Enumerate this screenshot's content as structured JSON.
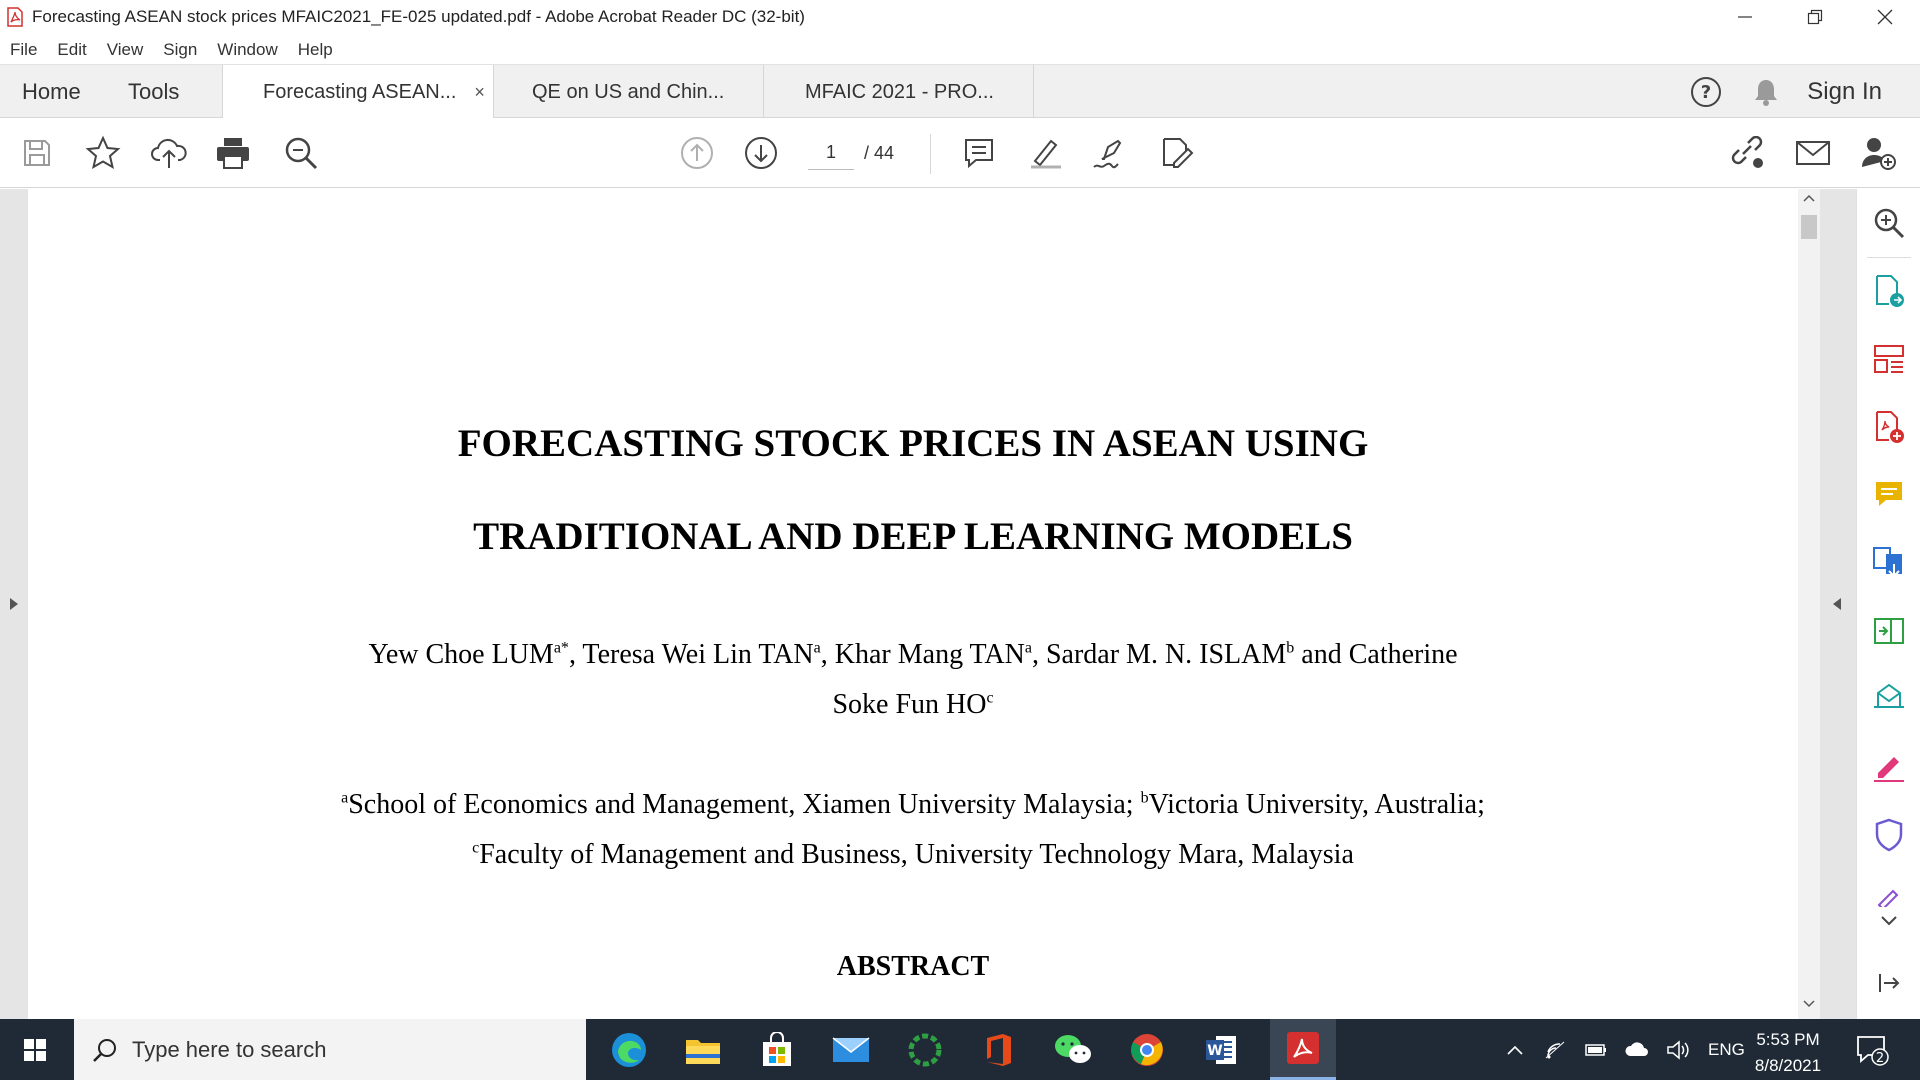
{
  "window": {
    "title": "Forecasting ASEAN stock prices MFAIC2021_FE-025 updated.pdf - Adobe Acrobat Reader DC (32-bit)",
    "app_icon": "acrobat-icon",
    "controls": [
      "minimize-icon",
      "restore-icon",
      "close-icon"
    ]
  },
  "menu": {
    "items": [
      "File",
      "Edit",
      "View",
      "Sign",
      "Window",
      "Help"
    ]
  },
  "tabs": {
    "home": "Home",
    "tools": "Tools",
    "documents": [
      {
        "label": "Forecasting ASEAN...",
        "active": true,
        "close": "×"
      },
      {
        "label": "QE on US and Chin...",
        "active": false
      },
      {
        "label": "MFAIC 2021 - PRO...",
        "active": false
      }
    ],
    "sign_in": "Sign In"
  },
  "toolbar": {
    "page_current": "1",
    "page_total": "/ 44"
  },
  "document": {
    "title_line1": "FORECASTING STOCK PRICES IN ASEAN USING",
    "title_line2": "TRADITIONAL AND DEEP LEARNING MODELS",
    "authors_line1": {
      "a1": "Yew Choe LUM",
      "a1_sup": "a*",
      "a2": ", Teresa Wei Lin TAN",
      "a2_sup": "a",
      "a3": ", Khar Mang TAN",
      "a3_sup": "a",
      "a4": ", Sardar M. N. ISLAM",
      "a4_sup": "b",
      "a5": " and Catherine"
    },
    "authors_line2": {
      "text": "Soke Fun HO",
      "sup": "c"
    },
    "affil_line1": {
      "sup1": "a",
      "t1": "School of Economics and Management, Xiamen University Malaysia; ",
      "sup2": "b",
      "t2": "Victoria University, Australia;"
    },
    "affil_line2": {
      "sup": "c",
      "text": "Faculty of Management and Business, University Technology Mara, Malaysia"
    },
    "abstract_heading": "ABSTRACT"
  },
  "taskbar": {
    "search_placeholder": "Type here to search",
    "apps": [
      "edge-icon",
      "file-explorer-icon",
      "store-icon",
      "mail-icon",
      "loading-app-icon",
      "office-icon",
      "wechat-icon",
      "chrome-icon",
      "word-icon",
      "acrobat-icon"
    ],
    "language": "ENG",
    "time": "5:53 PM",
    "date": "8/8/2021",
    "notifications": "2"
  },
  "colors": {
    "acrobat_red": "#d3302f",
    "tool_teal": "#1aa0a0",
    "tool_blue": "#2d72d2",
    "taskbar_bg": "#1f2a36"
  }
}
